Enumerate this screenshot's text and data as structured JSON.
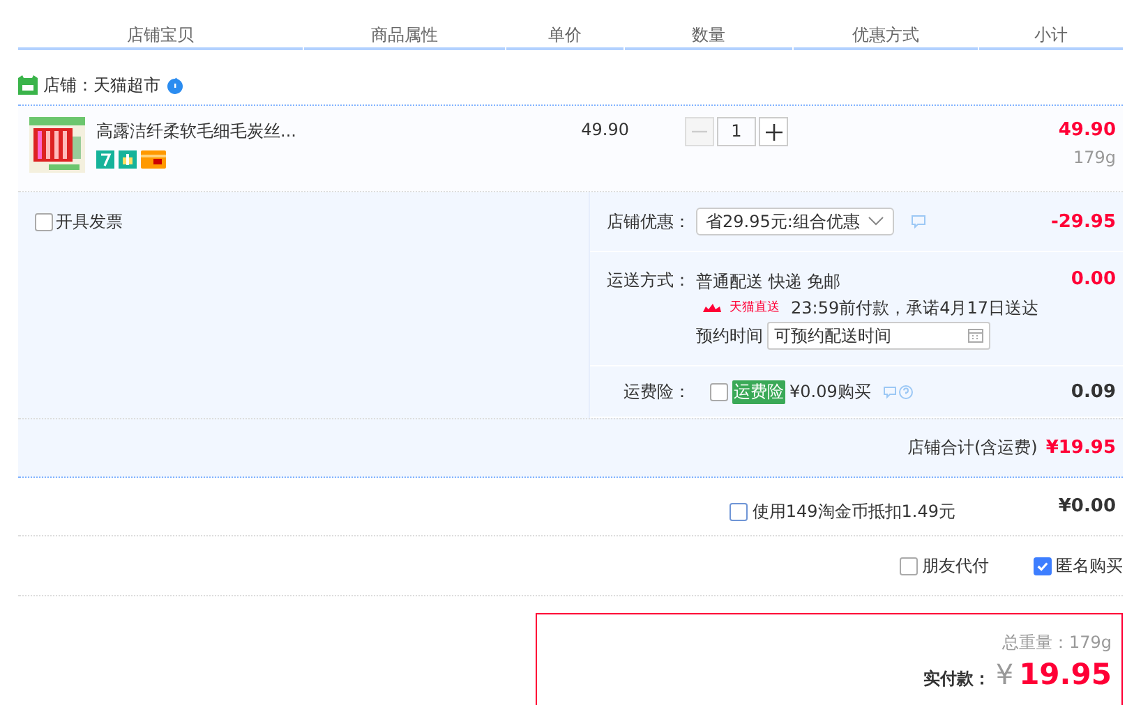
{
  "columns": [
    "店铺宝贝",
    "商品属性",
    "单价",
    "数量",
    "优惠方式",
    "小计"
  ],
  "shop": {
    "label": "店铺：天猫超市"
  },
  "item": {
    "title": "高露洁纤柔软毛细毛炭丝...",
    "price": "49.90",
    "quantity": "1",
    "minus_disabled": true,
    "subtotal": "49.90",
    "weight": "179g"
  },
  "invoice": {
    "label": "开具发票",
    "checked": false
  },
  "discount": {
    "label": "店铺优惠：",
    "selection": "省29.95元:组合优惠",
    "amount": "-29.95"
  },
  "shipping": {
    "label": "运送方式：",
    "method": "普通配送 快递 免邮",
    "badge": "天猫直送",
    "promise": "23:59前付款，承诺4月17日送达",
    "time_label": "预约时间",
    "time_placeholder": "可预约配送时间",
    "amount": "0.00"
  },
  "insurance": {
    "label": "运费险：",
    "checked": false,
    "tag": "运费险",
    "price": "¥0.09购买",
    "amount": "0.09"
  },
  "shop_total": {
    "label": "店铺合计(含运费)",
    "amount": "¥19.95"
  },
  "coins": {
    "label": "使用149淘金币抵扣1.49元",
    "checked": false,
    "amount": "¥0.00"
  },
  "options": [
    {
      "label": "朋友代付",
      "checked": false
    },
    {
      "label": "匿名购买",
      "checked": true
    }
  ],
  "summary": {
    "weight_label": "总重量：",
    "weight": "179g",
    "pay_label": "实付款：",
    "currency": "¥",
    "amount": "19.95"
  }
}
